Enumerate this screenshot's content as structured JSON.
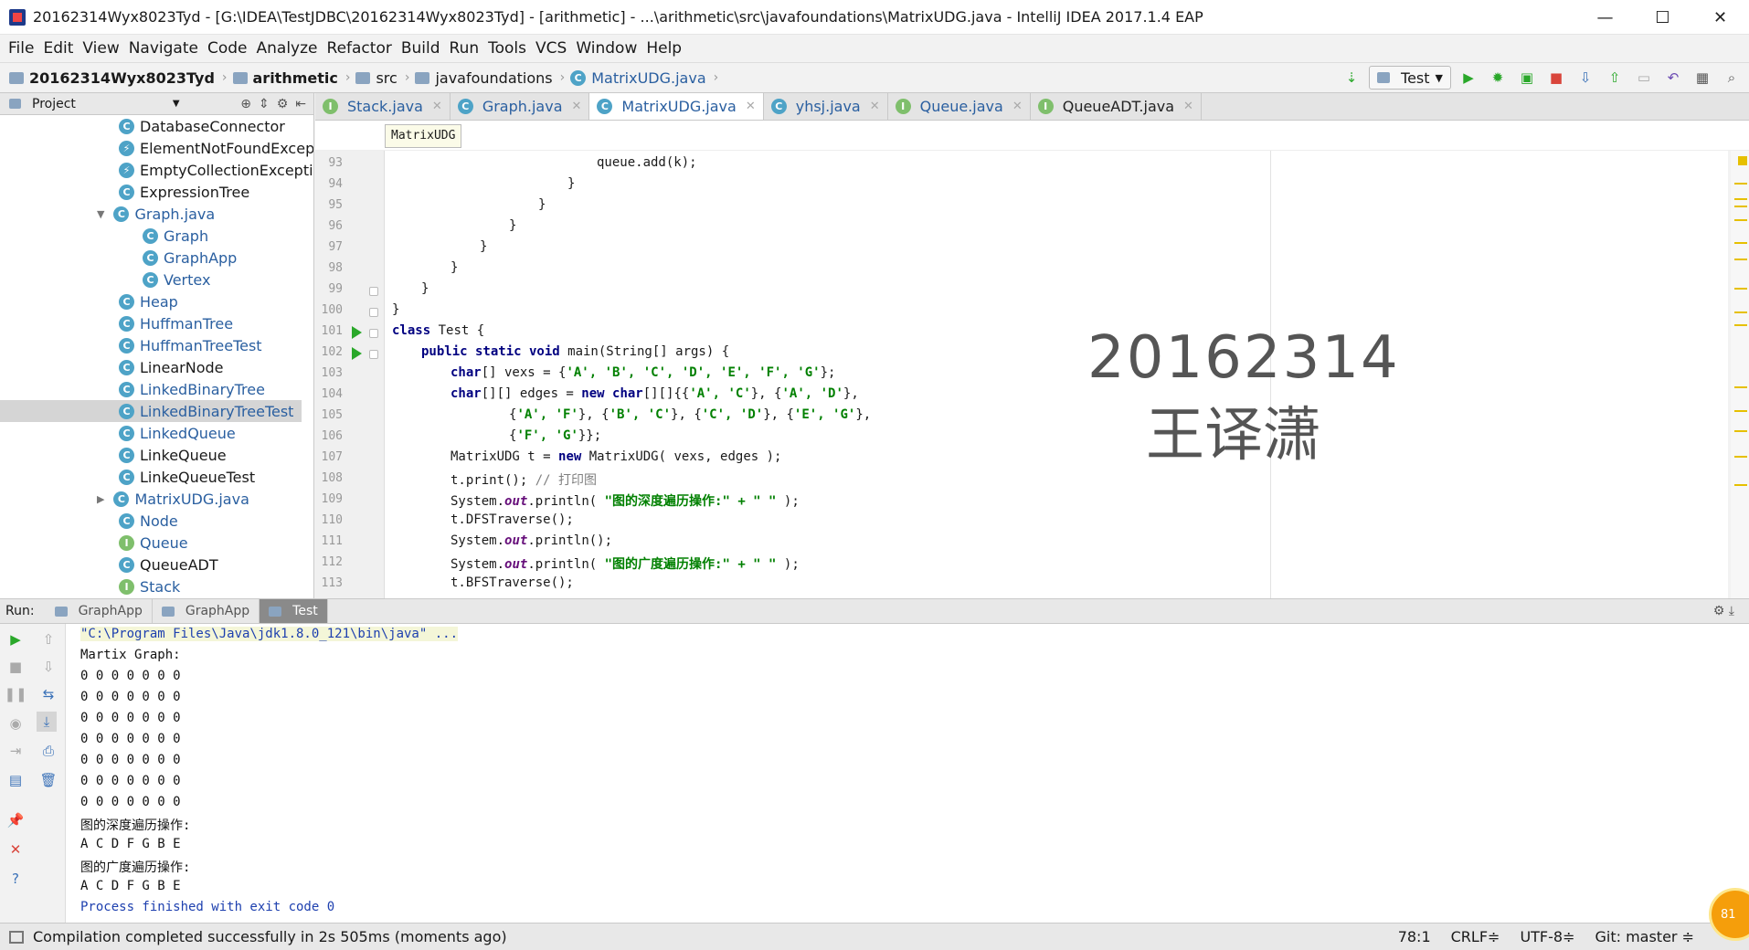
{
  "window": {
    "title": "20162314Wyx8023Tyd - [G:\\IDEA\\TestJDBC\\20162314Wyx8023Tyd] - [arithmetic] - ...\\arithmetic\\src\\javafoundations\\MatrixUDG.java - IntelliJ IDEA 2017.1.4 EAP",
    "controls": [
      "—",
      "☐",
      "✕"
    ]
  },
  "menu": [
    "File",
    "Edit",
    "View",
    "Navigate",
    "Code",
    "Analyze",
    "Refactor",
    "Build",
    "Run",
    "Tools",
    "VCS",
    "Window",
    "Help"
  ],
  "breadcrumb": [
    "20162314Wyx8023Tyd",
    "arithmetic",
    "src",
    "javafoundations",
    "MatrixUDG.java"
  ],
  "run_config": "Test",
  "project_panel": {
    "title": "Project"
  },
  "tree": [
    {
      "label": "DatabaseConnector",
      "kind": "c"
    },
    {
      "label": "ElementNotFoundExcep",
      "kind": "c"
    },
    {
      "label": "EmptyCollectionExcepti",
      "kind": "c"
    },
    {
      "label": "ExpressionTree",
      "kind": "c"
    },
    {
      "label": "Graph.java",
      "kind": "c"
    },
    {
      "label": "Graph",
      "kind": "c"
    },
    {
      "label": "GraphApp",
      "kind": "c"
    },
    {
      "label": "Vertex",
      "kind": "c"
    },
    {
      "label": "Heap",
      "kind": "c"
    },
    {
      "label": "HuffmanTree",
      "kind": "c"
    },
    {
      "label": "HuffmanTreeTest",
      "kind": "c"
    },
    {
      "label": "LinearNode",
      "kind": "c"
    },
    {
      "label": "LinkedBinaryTree",
      "kind": "c"
    },
    {
      "label": "LinkedBinaryTreeTest",
      "kind": "c"
    },
    {
      "label": "LinkedQueue",
      "kind": "c"
    },
    {
      "label": "LinkeQueue",
      "kind": "c"
    },
    {
      "label": "LinkeQueueTest",
      "kind": "c"
    },
    {
      "label": "MatrixUDG.java",
      "kind": "c"
    },
    {
      "label": "Node",
      "kind": "c"
    },
    {
      "label": "Queue",
      "kind": "i"
    },
    {
      "label": "QueueADT",
      "kind": "c"
    },
    {
      "label": "Stack",
      "kind": "i"
    }
  ],
  "editor_tabs": [
    "Stack.java",
    "Graph.java",
    "MatrixUDG.java",
    "yhsj.java",
    "Queue.java",
    "QueueADT.java"
  ],
  "structure_tip": "MatrixUDG",
  "line_numbers": [
    "93",
    "94",
    "95",
    "96",
    "97",
    "98",
    "99",
    "100",
    "101",
    "102",
    "103",
    "104",
    "105",
    "106",
    "107",
    "108",
    "109",
    "110",
    "111",
    "112",
    "113"
  ],
  "code": {
    "l93": "queue.add(k);",
    "l94": "}",
    "l95": "}",
    "l96": "}",
    "l97": "}",
    "l98": "}",
    "l99": "}",
    "l100": "}",
    "l101_kw": "class",
    "l101_rest": " Test {",
    "l102_kw": "public static void",
    "l102_rest": " main(String[] args) {",
    "l103_kw": "char",
    "l103_rest": "[] vexs = {",
    "l103_str": "'A', 'B', 'C', 'D', 'E', 'F', 'G'",
    "l103_end": "};",
    "l104_kw": "char",
    "l104_a": "[][] edges = ",
    "l104_kw2": "new char",
    "l104_b": "[][]{{",
    "l104_s1": "'A', 'C'",
    "l104_c": "}, {",
    "l104_s2": "'A', 'D'",
    "l104_d": "},",
    "l105_a": "{",
    "l105_s1": "'A', 'F'",
    "l105_b": "}, {",
    "l105_s2": "'B', 'C'",
    "l105_c": "}, {",
    "l105_s3": "'C', 'D'",
    "l105_d": "}, {",
    "l105_s4": "'E', 'G'",
    "l105_e": "},",
    "l106_a": "{",
    "l106_s1": "'F', 'G'",
    "l106_b": "}};",
    "l107_a": "MatrixUDG t = ",
    "l107_kw": "new",
    "l107_b": " MatrixUDG( vexs, edges );",
    "l108_a": "t.print(); ",
    "l108_cm": "// 打印图",
    "l109_a": "System.",
    "l109_out": "out",
    "l109_b": ".println( ",
    "l109_s": "\"图的深度遍历操作:\" + \" \"",
    "l109_c": " );",
    "l110": "t.DFSTraverse();",
    "l111_a": "System.",
    "l111_out": "out",
    "l111_b": ".println();",
    "l112_a": "System.",
    "l112_out": "out",
    "l112_b": ".println( ",
    "l112_s": "\"图的广度遍历操作:\" + \" \"",
    "l112_c": " );",
    "l113": "t.BFSTraverse();"
  },
  "watermark": {
    "line1": "20162314",
    "line2": "王译潇"
  },
  "run_panel": {
    "label": "Run:",
    "tabs": [
      "GraphApp",
      "GraphApp",
      "Test"
    ]
  },
  "console": [
    "\"C:\\Program Files\\Java\\jdk1.8.0_121\\bin\\java\" ...",
    "Martix Graph:",
    "0 0 0 0 0 0 0",
    "0 0 0 0 0 0 0",
    "0 0 0 0 0 0 0",
    "0 0 0 0 0 0 0",
    "0 0 0 0 0 0 0",
    "0 0 0 0 0 0 0",
    "0 0 0 0 0 0 0",
    "图的深度遍历操作:",
    "A C D F G B E",
    "图的广度遍历操作:",
    "A C D F G B E",
    "",
    "Process finished with exit code 0"
  ],
  "status": {
    "message": "Compilation completed successfully in 2s 505ms (moments ago)",
    "position": "78:1",
    "line_sep": "CRLF≑",
    "encoding": "UTF-8≑",
    "git": "Git: master ≑"
  },
  "badge": "81",
  "colors": {
    "accent": "#2a5fa0",
    "run_green": "#2aa82a",
    "keyword": "#000080",
    "string": "#008000"
  }
}
